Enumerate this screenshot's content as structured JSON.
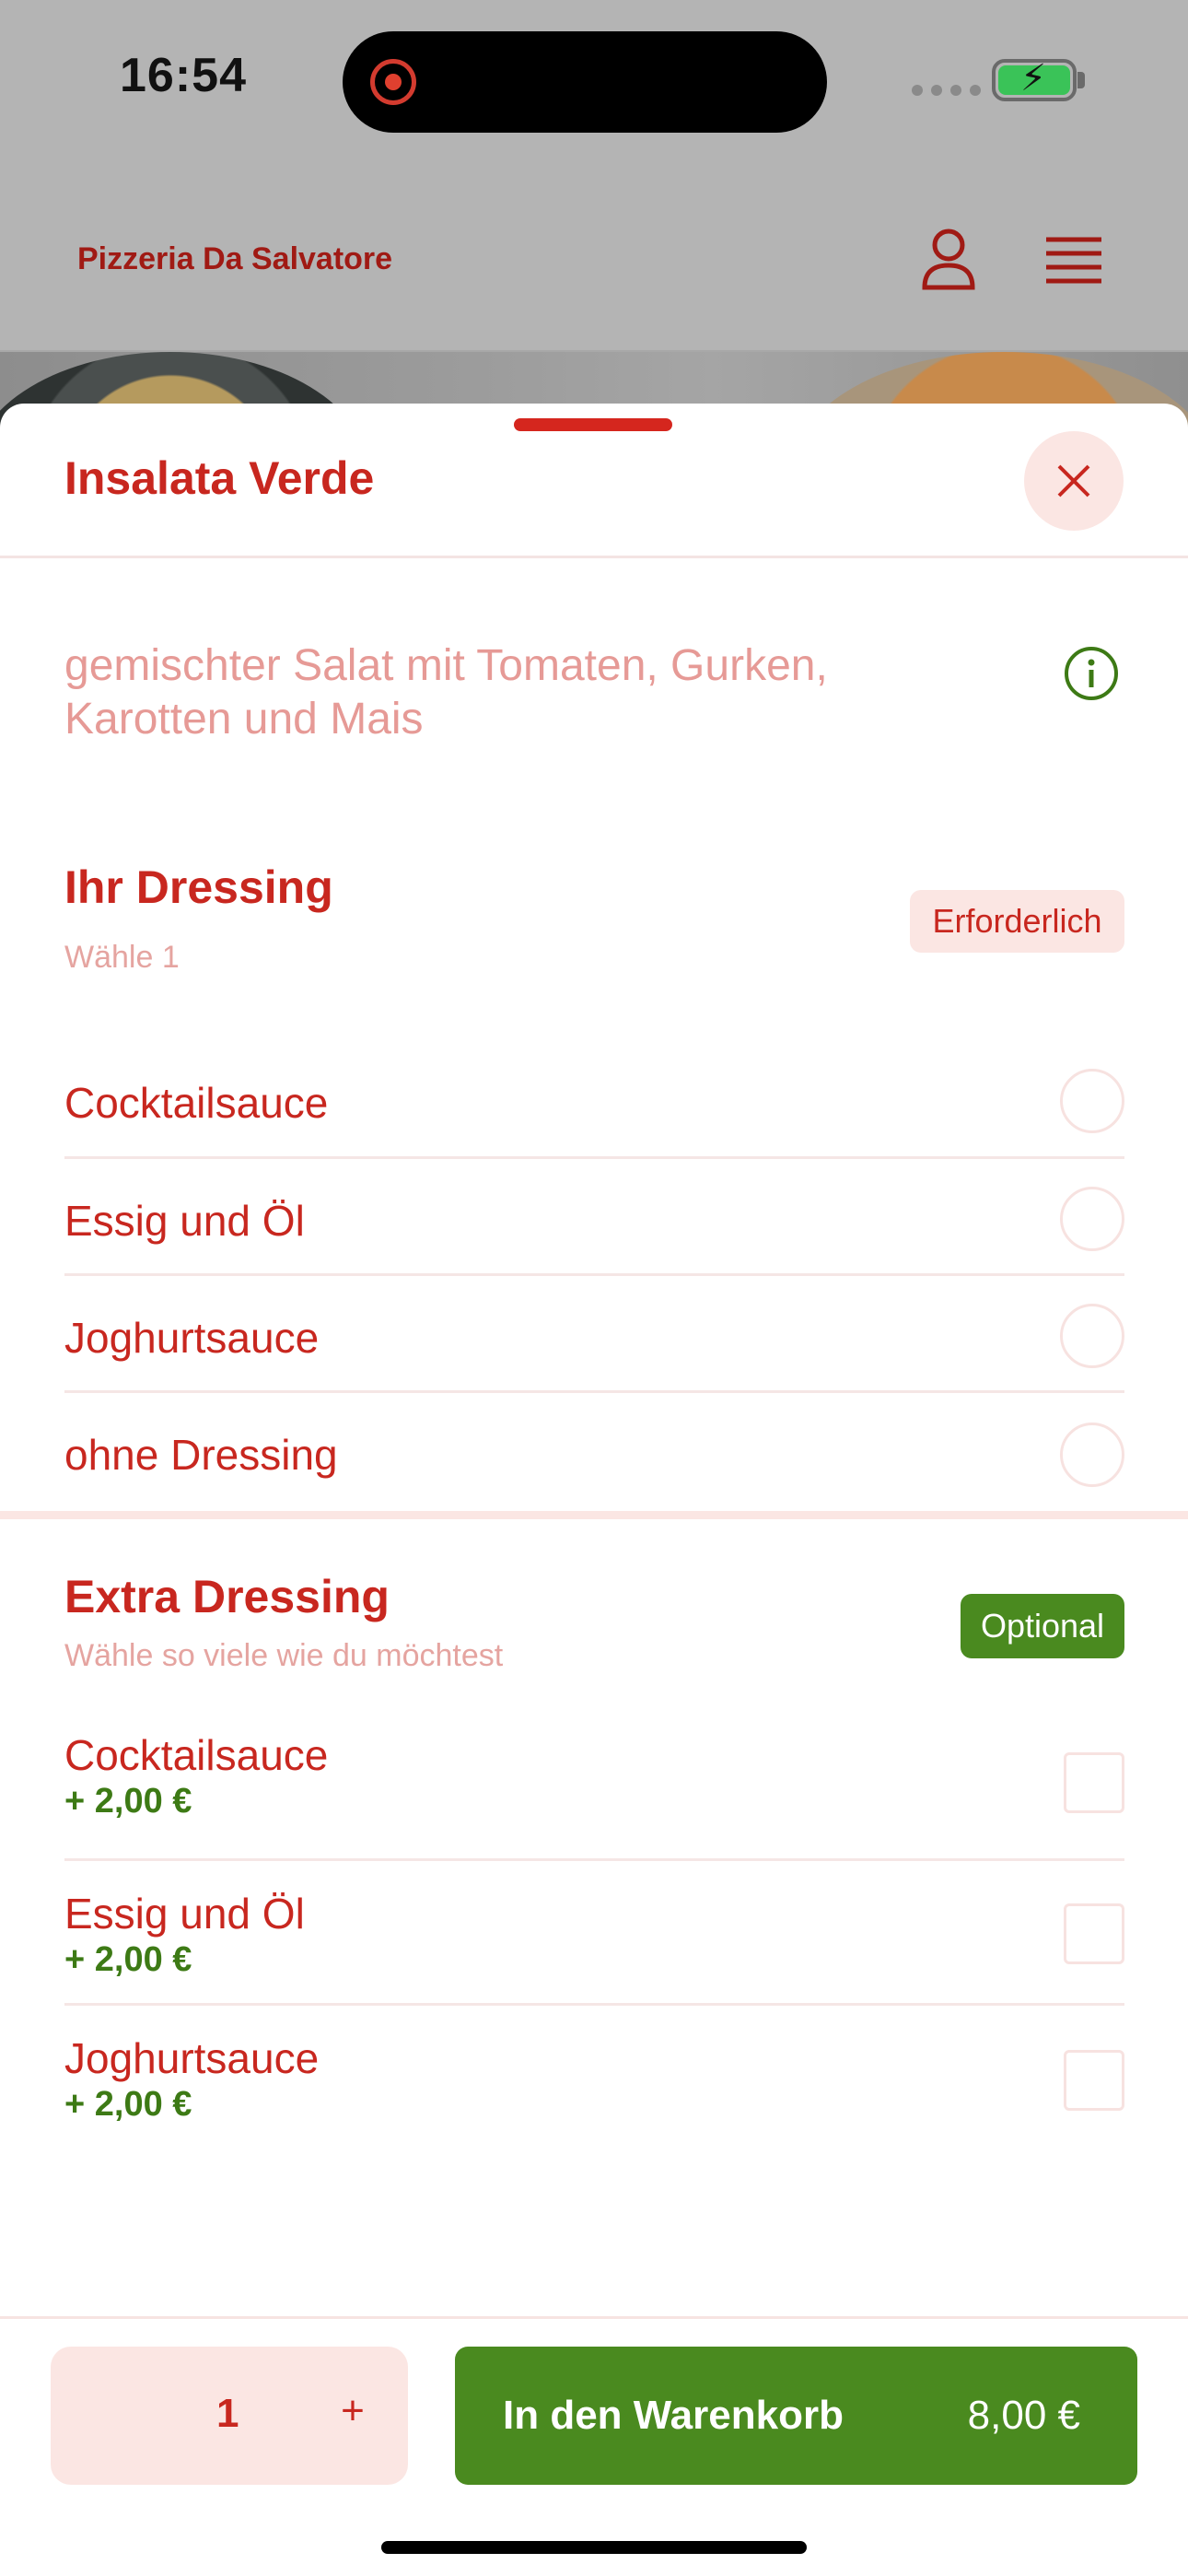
{
  "status_bar": {
    "time": "16:54"
  },
  "header": {
    "brand": "Pizzeria Da Salvatore"
  },
  "sheet": {
    "title": "Insalata Verde",
    "description": "gemischter Salat mit Tomaten, Gurken, Karotten und Mais"
  },
  "dressing_group": {
    "title": "Ihr Dressing",
    "subtitle": "Wähle 1",
    "badge": "Erforderlich",
    "options": [
      {
        "label": "Cocktailsauce"
      },
      {
        "label": "Essig und Öl"
      },
      {
        "label": "Joghurtsauce"
      },
      {
        "label": "ohne Dressing"
      }
    ]
  },
  "extra_group": {
    "title": "Extra Dressing",
    "subtitle": "Wähle so viele wie du möchtest",
    "badge": "Optional",
    "options": [
      {
        "label": "Cocktailsauce",
        "price": "+ 2,00 €"
      },
      {
        "label": "Essig und Öl",
        "price": "+ 2,00 €"
      },
      {
        "label": "Joghurtsauce",
        "price": "+ 2,00 €"
      }
    ]
  },
  "bottom_bar": {
    "quantity": "1",
    "plus": "+",
    "cart_label": "In den Warenkorb",
    "cart_price": "8,00 €"
  },
  "colors": {
    "accent_red": "#c8271f",
    "accent_green": "#4a8a1f",
    "light_pink": "#fbe6e3"
  }
}
